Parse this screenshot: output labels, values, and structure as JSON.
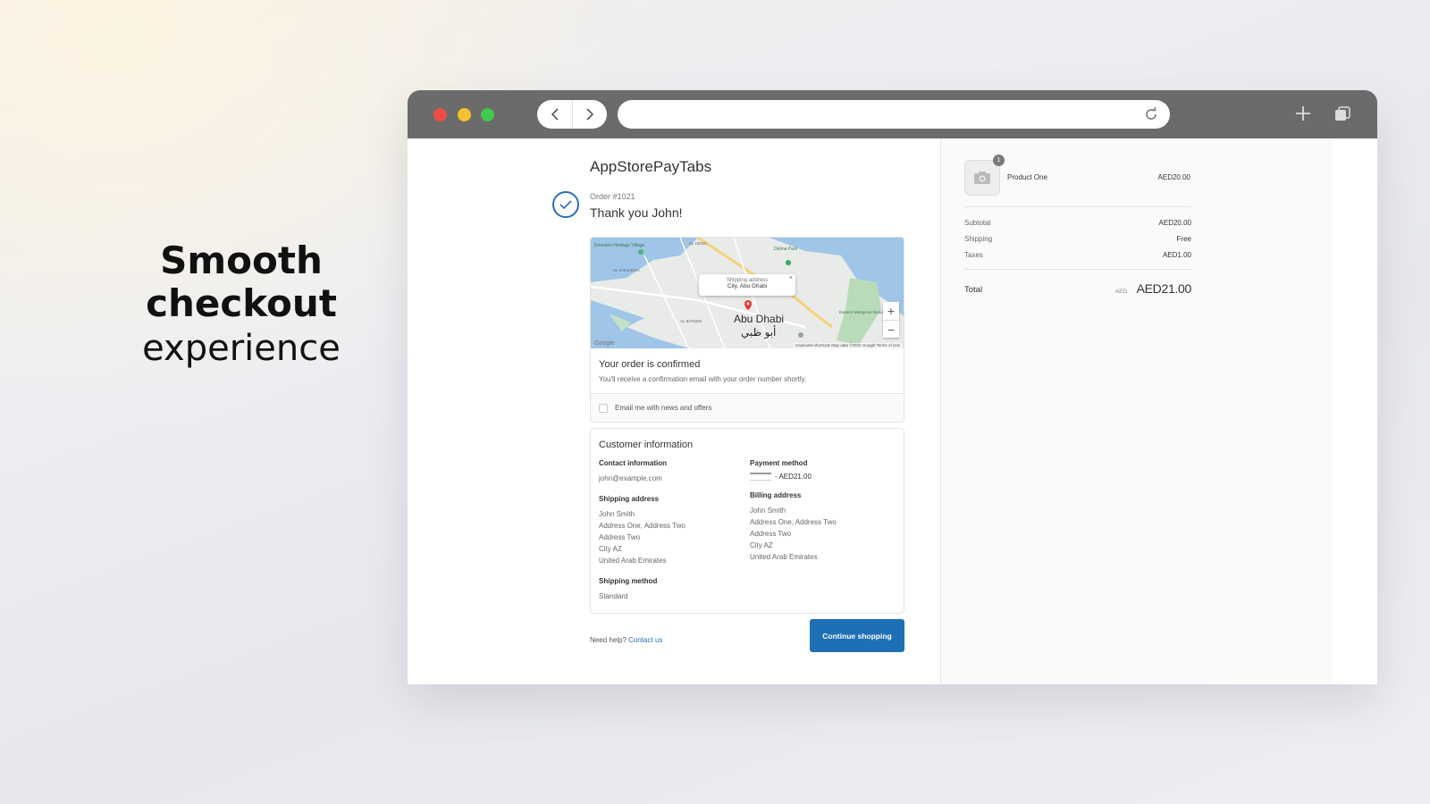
{
  "headline": {
    "line1": "Smooth",
    "line2": "checkout",
    "line3": "experience"
  },
  "store_name": "AppStorePayTabs",
  "order": {
    "number": "Order #1021",
    "thank_you": "Thank you John!"
  },
  "map": {
    "popup_label": "Shipping address",
    "popup_value": "City, Abu Dhabi",
    "city_en": "Abu Dhabi",
    "city_ar": "أبو ظبي",
    "labels": [
      "Emirates Heritage Village",
      "Delma Park",
      "AL KHALIDIYA",
      "AL BATEEN",
      "Eastern Mangrove National Park",
      "AL HOSN"
    ],
    "zoom_in": "+",
    "zoom_out": "−",
    "google": "Google",
    "footer": "Keyboard shortcuts   Map data ©2022 Google   Terms of Use"
  },
  "confirmation": {
    "title": "Your order is confirmed",
    "subtitle": "You'll receive a confirmation email with your order number shortly.",
    "email_opt_in": "Email me with news and offers"
  },
  "customer": {
    "title": "Customer information",
    "contact_label": "Contact information",
    "contact_value": "john@example.com",
    "payment_label": "Payment method",
    "payment_value": "- AED21.00",
    "shipping_address_label": "Shipping address",
    "shipping_address": [
      "John Smith",
      "Address One, Address Two",
      "Address Two",
      "City AZ",
      "United Arab Emirates"
    ],
    "billing_address_label": "Billing address",
    "billing_address": [
      "John Smith",
      "Address One, Address Two",
      "Address Two",
      "City AZ",
      "United Arab Emirates"
    ],
    "shipping_method_label": "Shipping method",
    "shipping_method": "Standard"
  },
  "footer": {
    "help": "Need help?",
    "contact": "Contact us",
    "continue": "Continue shopping"
  },
  "summary": {
    "quantity": "1",
    "product": "Product One",
    "product_price": "AED20.00",
    "subtotal_label": "Subtotal",
    "subtotal": "AED20.00",
    "shipping_label": "Shipping",
    "shipping": "Free",
    "taxes_label": "Taxes",
    "taxes": "AED1.00",
    "total_label": "Total",
    "currency": "AED",
    "total": "AED21.00"
  },
  "colors": {
    "primary": "#1f6fb5",
    "check": "#2a6ebb",
    "chrome": "#6b6b6b"
  }
}
